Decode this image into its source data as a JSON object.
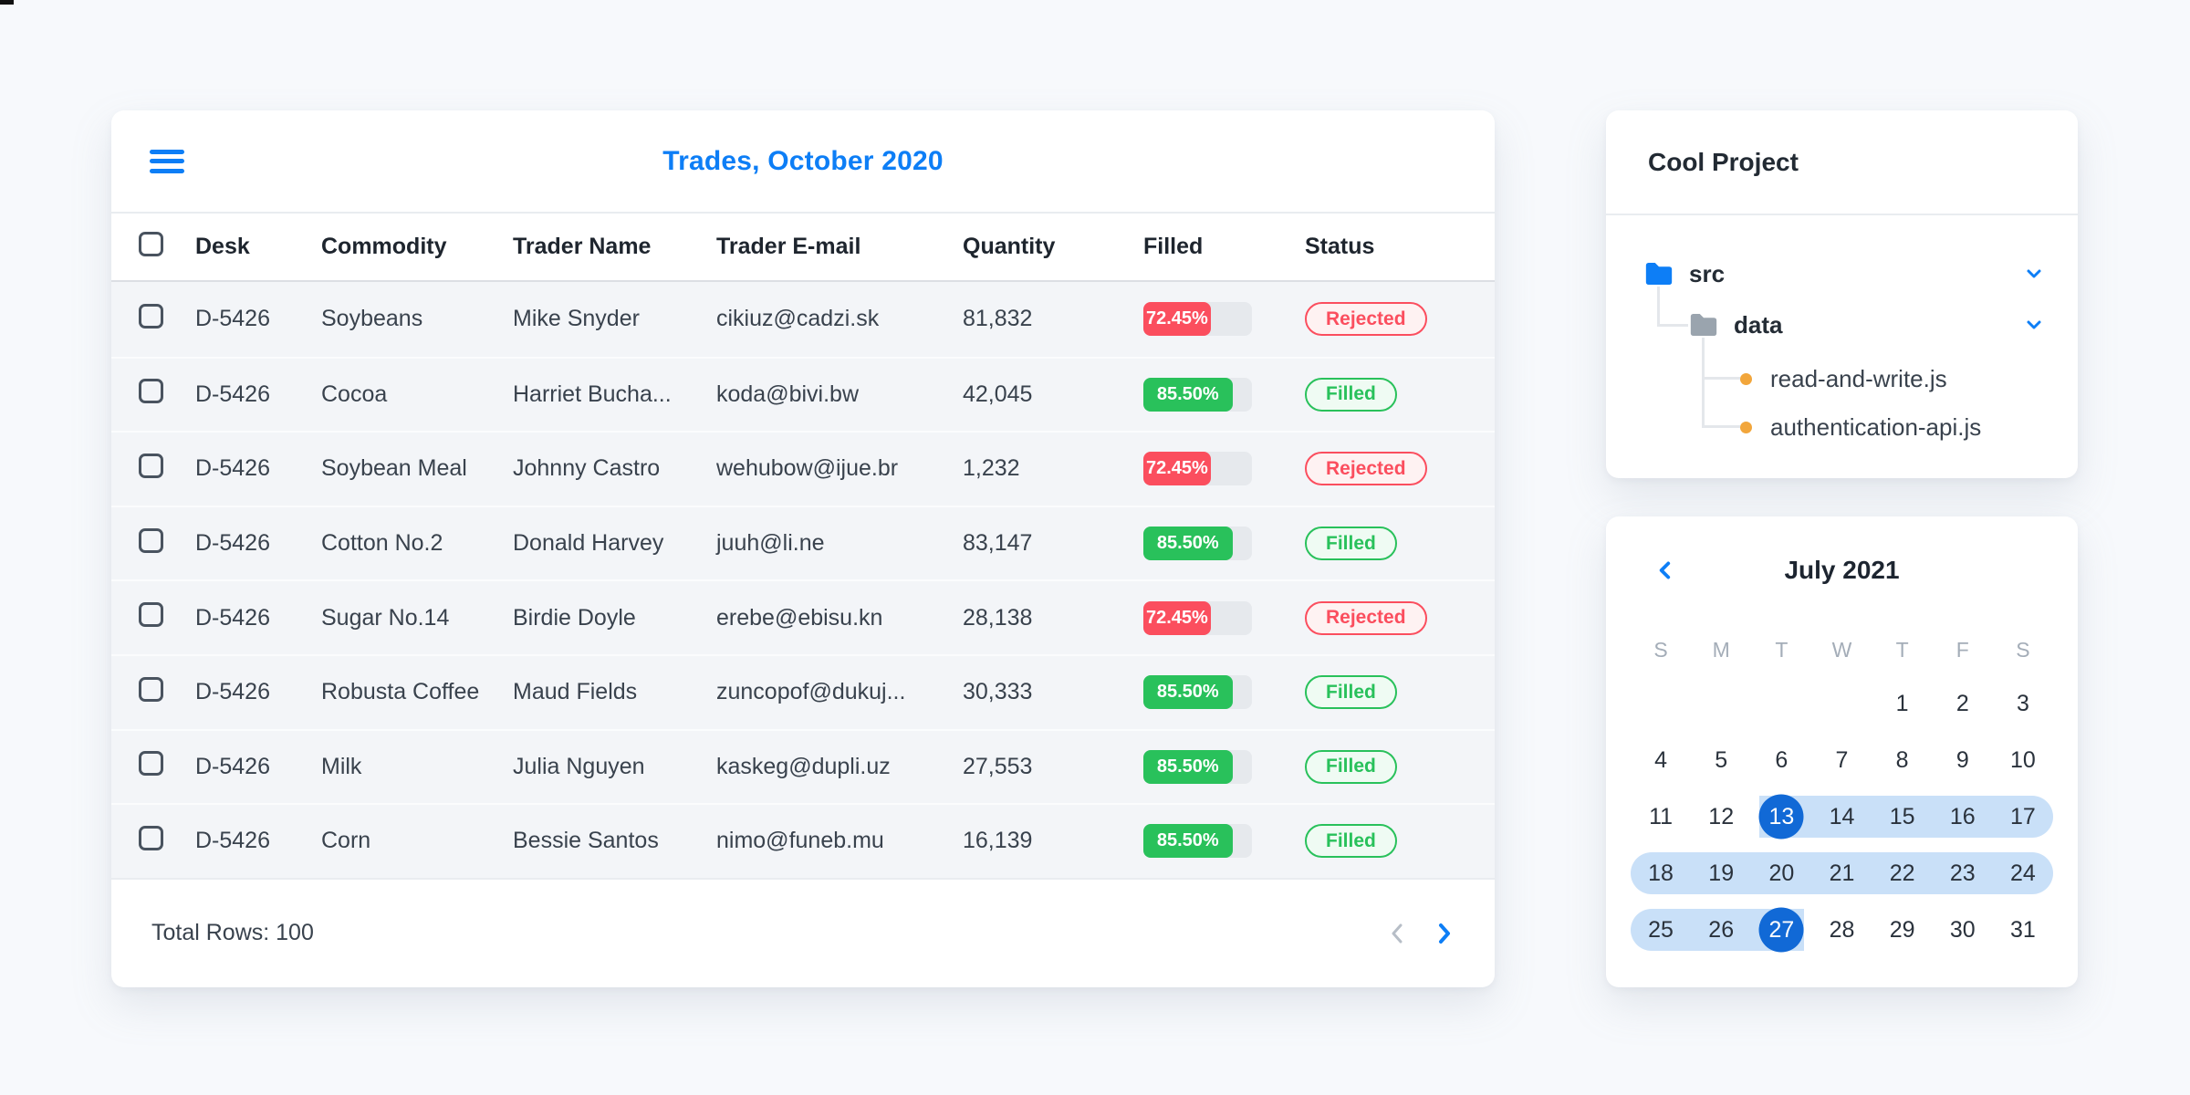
{
  "trades": {
    "title": "Trades, October 2020",
    "columns": [
      "Desk",
      "Commodity",
      "Trader Name",
      "Trader E-mail",
      "Quantity",
      "Filled",
      "Status"
    ],
    "rows": [
      {
        "desk": "D-5426",
        "commodity": "Soybeans",
        "trader": "Mike Snyder",
        "email": "cikiuz@cadzi.sk",
        "quantity": "81,832",
        "filled": "72.45%",
        "status": "Rejected"
      },
      {
        "desk": "D-5426",
        "commodity": "Cocoa",
        "trader": "Harriet Bucha...",
        "email": "koda@bivi.bw",
        "quantity": "42,045",
        "filled": "85.50%",
        "status": "Filled"
      },
      {
        "desk": "D-5426",
        "commodity": "Soybean Meal",
        "trader": "Johnny Castro",
        "email": "wehubow@ijue.br",
        "quantity": "1,232",
        "filled": "72.45%",
        "status": "Rejected"
      },
      {
        "desk": "D-5426",
        "commodity": "Cotton No.2",
        "trader": "Donald Harvey",
        "email": "juuh@li.ne",
        "quantity": "83,147",
        "filled": "85.50%",
        "status": "Filled"
      },
      {
        "desk": "D-5426",
        "commodity": "Sugar No.14",
        "trader": "Birdie Doyle",
        "email": "erebe@ebisu.kn",
        "quantity": "28,138",
        "filled": "72.45%",
        "status": "Rejected"
      },
      {
        "desk": "D-5426",
        "commodity": "Robusta Coffee",
        "trader": "Maud Fields",
        "email": "zuncopof@dukuj...",
        "quantity": "30,333",
        "filled": "85.50%",
        "status": "Filled"
      },
      {
        "desk": "D-5426",
        "commodity": "Milk",
        "trader": "Julia Nguyen",
        "email": "kaskeg@dupli.uz",
        "quantity": "27,553",
        "filled": "85.50%",
        "status": "Filled"
      },
      {
        "desk": "D-5426",
        "commodity": "Corn",
        "trader": "Bessie Santos",
        "email": "nimo@funeb.mu",
        "quantity": "16,139",
        "filled": "85.50%",
        "status": "Filled"
      }
    ],
    "footer": {
      "total_rows": "Total Rows: 100"
    }
  },
  "file_tree": {
    "title": "Cool Project",
    "root_folder": "src",
    "sub_folder": "data",
    "files": [
      "read-and-write.js",
      "authentication-api.js"
    ]
  },
  "calendar": {
    "title": "July 2021",
    "weekdays": [
      "S",
      "M",
      "T",
      "W",
      "T",
      "F",
      "S"
    ],
    "weeks": [
      [
        "",
        "",
        "",
        "",
        "1",
        "2",
        "3"
      ],
      [
        "4",
        "5",
        "6",
        "7",
        "8",
        "9",
        "10"
      ],
      [
        "11",
        "12",
        "13",
        "14",
        "15",
        "16",
        "17"
      ],
      [
        "18",
        "19",
        "20",
        "21",
        "22",
        "23",
        "24"
      ],
      [
        "25",
        "26",
        "27",
        "28",
        "29",
        "30",
        "31"
      ]
    ],
    "range_start": "13",
    "range_end": "27"
  },
  "colors": {
    "accent_blue": "#0d7ef6",
    "selected_day_blue": "#1169d6",
    "range_band_blue": "#c9e0f8",
    "negative_red": "#fb4e5e",
    "positive_green": "#29c15b"
  }
}
